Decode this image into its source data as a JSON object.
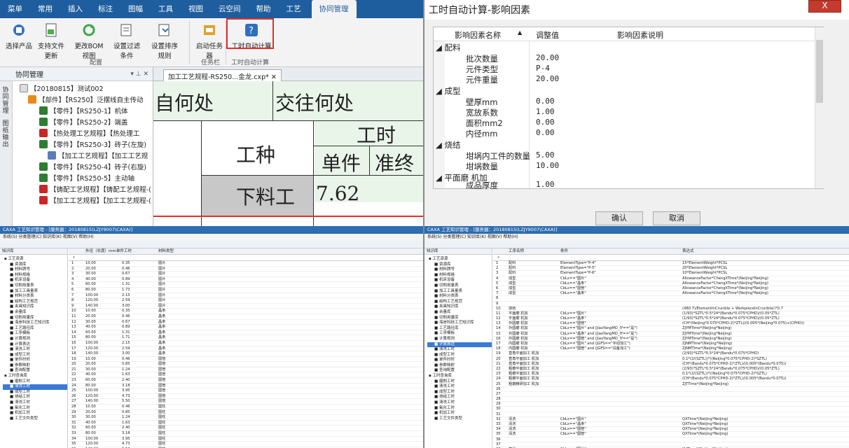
{
  "ribbon": {
    "menu": [
      "菜单",
      "常用",
      "插入",
      "标注",
      "图幅",
      "工具",
      "视图",
      "云空间",
      "帮助",
      "工艺",
      "协同管理"
    ],
    "active_menu": "协同管理",
    "buttons": [
      "选择产品",
      "支持文件更新",
      "更改BOM视图",
      "设置过滤条件",
      "设置排序规则",
      "启动任务器",
      "工时自动计算"
    ],
    "groups": [
      "配置",
      "任务栏",
      "工时自动计算"
    ]
  },
  "tree": {
    "title": "协同管理",
    "side_tabs": [
      "协同管理",
      "图纸输出"
    ],
    "rows": [
      "【20180815】测试002",
      "【部件】【RS250】泛摆线自主传动",
      "【零件】【RS250-1】机体",
      "【零件】【RS250-2】端盖",
      "【热处理工艺规程】【热处理工",
      "【零件】【RS250-3】砖子(左旋)",
      "【加工工艺规程】【加工工艺规",
      "【零件】【RS250-4】砖子(右旋)",
      "【零件】【RS250-5】主动轴",
      "【铸配工艺规程】【铸配工艺规程-(",
      "【加工工艺规程】【加工工艺规程-("
    ]
  },
  "doc": {
    "tab": "加工工艺规程-RS250...金龙.cxp*",
    "cell_a": "自何处",
    "cell_b": "交往何处",
    "col_type": "工种",
    "col_time": "工时",
    "col_unit": "单件",
    "col_final": "准终",
    "row_type": "下料工",
    "row_time": "7.62"
  },
  "dialog": {
    "title": "工时自动计算-影响因素",
    "close": "X",
    "headers": [
      "影响因素名称",
      "调整值",
      "影响因素说明"
    ],
    "sections": [
      {
        "name": "配料",
        "items": [
          [
            "批次数量",
            "20.00"
          ],
          [
            "元件类型",
            "P-4"
          ],
          [
            "元件重量",
            "20.00"
          ]
        ]
      },
      {
        "name": "成型",
        "items": [
          [
            "壁厚mm",
            "0.00"
          ],
          [
            "宽放系数",
            "1.00"
          ],
          [
            "面积mm2",
            "0.00"
          ],
          [
            "内径mm",
            "0.00"
          ]
        ]
      },
      {
        "name": "烧结",
        "items": [
          [
            "坩埚内工件的数量",
            "5.00"
          ],
          [
            "坩埚数量",
            "10.00"
          ]
        ]
      },
      {
        "name": "平面磨 机加",
        "items": [
          [
            "成品厚度",
            "1.00"
          ]
        ]
      }
    ],
    "ok": "确认",
    "cancel": "取消"
  },
  "bottom_left": {
    "title": "CAXA 工艺知识管理 - [服务器：20180815(LZJY9007\\CAXA)]",
    "menu": "系统(S)   分类管理(C)   知识库(K)   视图(V)   帮助(H)",
    "panel_title": "知识库",
    "columns": [
      "外径（长度）mm",
      "单件工时",
      "材料类型"
    ],
    "tree": [
      "工艺资源",
      "资源库",
      "材料牌号",
      "材料规格",
      "机床设备",
      "切削用量表",
      "加工工具量表",
      "材料分类表",
      "结构工艺规范",
      "夹具知识库",
      "余量库",
      "切削用量库",
      "海岸科技工艺知识库",
      "工艺路径库",
      "工序模板",
      "计算规则",
      "计算表达",
      "清洗工时",
      "成型工时",
      "单件时时",
      "参数映射",
      "查询配置",
      "工时查询库",
      "磨削工时",
      "清洗工时",
      "成型工时",
      "烧结工时",
      "清洗工时",
      "氧化工时",
      "机加工时",
      "工艺文件类型"
    ],
    "rows": [
      [
        "1",
        "10.00",
        "0.35",
        "圆片"
      ],
      [
        "2",
        "20.00",
        "0.46",
        "圆片"
      ],
      [
        "3",
        "30.00",
        "0.67",
        "圆片"
      ],
      [
        "4",
        "40.00",
        "0.89",
        "圆片"
      ],
      [
        "5",
        "60.00",
        "1.31",
        "圆片"
      ],
      [
        "6",
        "80.00",
        "1.73",
        "圆片"
      ],
      [
        "7",
        "100.00",
        "2.15",
        "圆片"
      ],
      [
        "8",
        "120.00",
        "2.59",
        "圆片"
      ],
      [
        "9",
        "140.00",
        "3.00",
        "圆片"
      ],
      [
        "10",
        "10.00",
        "0.35",
        "晶条"
      ],
      [
        "11",
        "20.00",
        "0.46",
        "晶条"
      ],
      [
        "12",
        "30.00",
        "0.67",
        "晶条"
      ],
      [
        "13",
        "40.00",
        "0.89",
        "晶条"
      ],
      [
        "14",
        "60.00",
        "1.31",
        "晶条"
      ],
      [
        "15",
        "80.00",
        "1.71",
        "晶条"
      ],
      [
        "16",
        "100.00",
        "2.15",
        "晶条"
      ],
      [
        "17",
        "120.00",
        "2.59",
        "晶条"
      ],
      [
        "18",
        "140.00",
        "3.00",
        "晶条"
      ],
      [
        "19",
        "10.00",
        "0.46",
        "圆管"
      ],
      [
        "20",
        "20.00",
        "0.85",
        "圆管"
      ],
      [
        "21",
        "30.00",
        "1.24",
        "圆管"
      ],
      [
        "22",
        "40.00",
        "1.63",
        "圆管"
      ],
      [
        "23",
        "60.00",
        "2.40",
        "圆管"
      ],
      [
        "24",
        "80.00",
        "3.18",
        "圆管"
      ],
      [
        "25",
        "100.00",
        "3.95",
        "圆管"
      ],
      [
        "26",
        "120.00",
        "4.73",
        "圆管"
      ],
      [
        "27",
        "140.00",
        "5.50",
        "圆管"
      ],
      [
        "28",
        "10.00",
        "0.46",
        "圆柱"
      ],
      [
        "29",
        "20.00",
        "0.85",
        "圆柱"
      ],
      [
        "30",
        "30.00",
        "1.24",
        "圆柱"
      ],
      [
        "31",
        "40.00",
        "1.63",
        "圆柱"
      ],
      [
        "32",
        "60.00",
        "2.40",
        "圆柱"
      ],
      [
        "33",
        "80.00",
        "3.18",
        "圆柱"
      ],
      [
        "34",
        "100.00",
        "3.95",
        "圆柱"
      ],
      [
        "35",
        "120.00",
        "4.73",
        "圆柱"
      ],
      [
        "36",
        "140.00",
        "5.50",
        "圆柱"
      ]
    ]
  },
  "bottom_right": {
    "title": "CAXA 工艺知识管理 - [服务器：20180815(LZJY9007\\CAXA)]",
    "menu": "系统(S)   分类管理(C)   知识库(K)   视图(V)   帮助(H)",
    "columns": [
      "工序名称",
      "条件",
      "表达式"
    ],
    "rows": [
      [
        "1",
        "配料",
        "ElementType=\"P-4\"",
        "15*ElementWeight*PCSL"
      ],
      [
        "2",
        "配料",
        "ElementType=\"P-5\"",
        "20*ElementWeight*PCSL"
      ],
      [
        "3",
        "配料",
        "ElementType=\"P-6\"",
        "10*ElementWeight*PCSL"
      ],
      [
        "4",
        "成型",
        "CbLx==\"圆片\"",
        "AllowanceFactor*ChengXTime*(Neijing*Neijing)"
      ],
      [
        "5",
        "成型",
        "CbLx==\"晶条\"",
        "AllowanceFactor*ChengXTime*(Neijing*Neijing)"
      ],
      [
        "6",
        "成型",
        "CbLx==\"圆管\"",
        "AllowanceFactor*ChengXTime*(Neijing*Neijing)"
      ],
      [
        "7",
        "成型",
        "CbLx==\"晶条\"",
        "AllowanceFactor*ChengXTime*(Neijing*Neijing)"
      ],
      [
        "8",
        "",
        "",
        ""
      ],
      [
        "9",
        "",
        "",
        ""
      ],
      [
        "10",
        "烧结",
        "",
        "(480.7)/ElementInCrucible + WorkpieceInCrucible()*0.7"
      ],
      [
        "11",
        "平面磨 机加",
        "CbLx==\"圆片\"",
        "(1/93)*SZTL*0.5*24*(Bandu*0.075*CPHD)/(0.05*ZTL)"
      ],
      [
        "12",
        "平面磨 机加",
        "CbLx==\"晶条\"",
        "(1/93)*SZTL*0.5*24*(Bandu*0.075*CPHD)/(0.05*ZTL)"
      ],
      [
        "13",
        "外圆磨 机加",
        "CbLx==\"圆管\"",
        "(CH*(Neijing*0.075*CPHD-2)*ZTL)/(0.005*(Neijing*0.075)+(CPHD))"
      ],
      [
        "14",
        "外圆磨 机加",
        "CbLx==\"圆片\" and (JiaoYangMO_IY==\"是\")",
        "ZJYMTime*(Neijing*Neijing)"
      ],
      [
        "15",
        "外圆磨 机加",
        "CbLx==\"晶条\" and (JiaoYangMO_IY==\"是\")",
        "ZJYMTime*(Neijing*Neijing)"
      ],
      [
        "16",
        "外圆磨 机加",
        "CbLx==\"圆管\" and (JiaoYangMO_IY==\"是\")",
        "ZJYMTime*(Neijing*Neijing)"
      ],
      [
        "17",
        "内圆磨 机加",
        "CbLx==\"圆片\" and (JGFS==\"手动加工\")",
        "ZJNMTime*(Neijing*Neijing)"
      ],
      [
        "18",
        "内圆磨 机加",
        "CbLx==\"圆管\" and (JGFS==\"设备加工\")",
        "ZJNMTime*(Neijing*Neijing)"
      ],
      [
        "19",
        "直角平面加工 机加",
        "",
        "(2/93)*SZTL*0.5*24*(Bandu*0.075*CPHD)"
      ],
      [
        "20",
        "直角平面加工 机加",
        "",
        "0.1*(2/(SZTL))*((Neijing*0.075*CPHD-2)*SZTL)"
      ],
      [
        "21",
        "直角平面加工 机加",
        "",
        "(CH*(Bandu*0.075*CPHD-2)*ZTL)/(0.005*(Bandu*0.075))"
      ],
      [
        "22",
        "粗磨平面加工 机加",
        "",
        "(2/93)*SZTL*0.5*24*(Bandu*0.075*CPHD)/(0.05*ZTL)"
      ],
      [
        "23",
        "粗磨平面加工 机加",
        "",
        "0.1*(2/(SZTL))*((Neijing*0.075*CPHD-2)*SZTL)"
      ],
      [
        "24",
        "粗磨平面加工 机加",
        "",
        "(CH*(Bandu*0.075*CPHD-2)*ZTL)/(0.005*(Bandu*0.075))"
      ],
      [
        "25",
        "粗磨精研加工 机加",
        "",
        "ZJTTime*(Neijing*Neijing)"
      ],
      [
        "26",
        "",
        "",
        ""
      ],
      [
        "27",
        "",
        "",
        ""
      ],
      [
        "28",
        "",
        "",
        ""
      ],
      [
        "29",
        "",
        "",
        ""
      ],
      [
        "30",
        "",
        "",
        ""
      ],
      [
        "31",
        "",
        "",
        ""
      ],
      [
        "32",
        "清洗",
        "CbLx==\"圆片\"",
        "QXTime*(Neijing*Neijing)"
      ],
      [
        "33",
        "清洗",
        "CbLx==\"晶条\"",
        "QXTime*(Neijing*Neijing)"
      ],
      [
        "34",
        "清洗",
        "CbLx==\"圆管\"",
        "QXTime*(Neijing*Neijing)"
      ],
      [
        "35",
        "清洗",
        "CbLx==\"圆管\"",
        "QXTime*(Neijing*Neijing)"
      ],
      [
        "36",
        "",
        "",
        ""
      ],
      [
        "37",
        "",
        "",
        ""
      ],
      [
        "38",
        "氧化",
        "CbLx==\"圆片\"",
        "YHTime*(Neijing*Neijing)"
      ]
    ]
  }
}
